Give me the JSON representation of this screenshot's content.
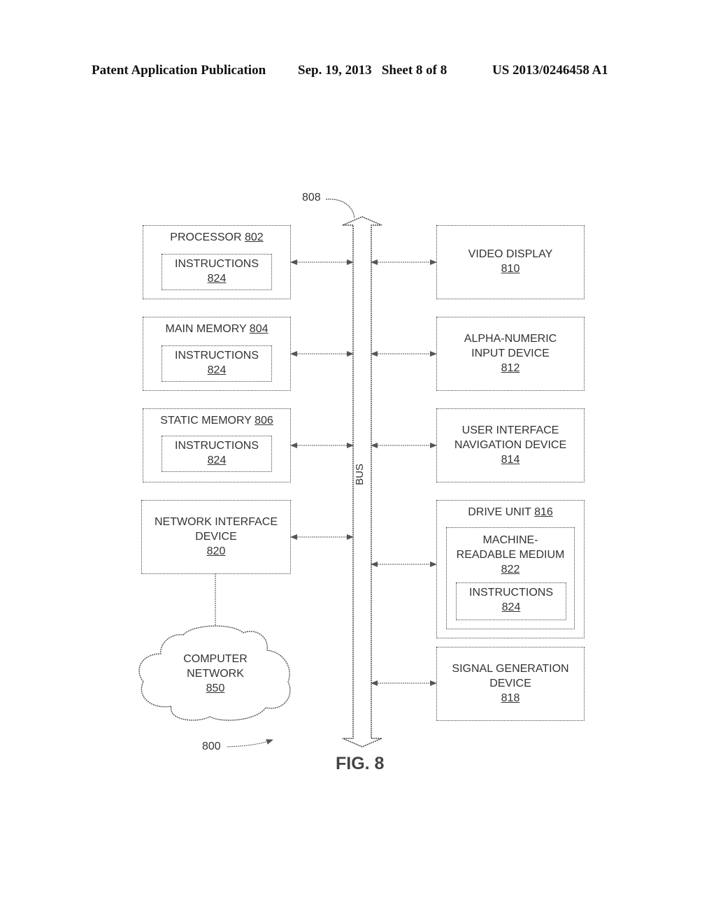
{
  "header": {
    "publication": "Patent Application Publication",
    "date_sheet": "Sep. 19, 2013   Sheet 8 of 8",
    "number": "US 2013/0246458 A1"
  },
  "diagram": {
    "bus_ref": "808",
    "bus_label": "BUS",
    "system_ref": "800",
    "figure": "FIG. 8",
    "processor": {
      "label": "PROCESSOR ",
      "ref": "802",
      "inner_label": "INSTRUCTIONS",
      "inner_ref": "824"
    },
    "main_memory": {
      "label": "MAIN MEMORY ",
      "ref": "804",
      "inner_label": "INSTRUCTIONS",
      "inner_ref": "824"
    },
    "static_memory": {
      "label": "STATIC MEMORY ",
      "ref": "806",
      "inner_label": "INSTRUCTIONS",
      "inner_ref": "824"
    },
    "network_interface": {
      "line1": "NETWORK INTERFACE",
      "line2": "DEVICE",
      "ref": "820"
    },
    "computer_network": {
      "line1": "COMPUTER",
      "line2": "NETWORK",
      "ref": "850"
    },
    "video_display": {
      "line1": "VIDEO DISPLAY",
      "ref": "810"
    },
    "alpha_numeric": {
      "line1": "ALPHA-NUMERIC",
      "line2": "INPUT DEVICE",
      "ref": "812"
    },
    "ui_navigation": {
      "line1": "USER INTERFACE",
      "line2": "NAVIGATION DEVICE",
      "ref": "814"
    },
    "drive_unit": {
      "label": "DRIVE UNIT ",
      "ref": "816",
      "medium_line1": "MACHINE-",
      "medium_line2": "READABLE MEDIUM",
      "medium_ref": "822",
      "inner_label": "INSTRUCTIONS",
      "inner_ref": "824"
    },
    "signal_generation": {
      "line1": "SIGNAL GENERATION",
      "line2": "DEVICE",
      "ref": "818"
    }
  }
}
